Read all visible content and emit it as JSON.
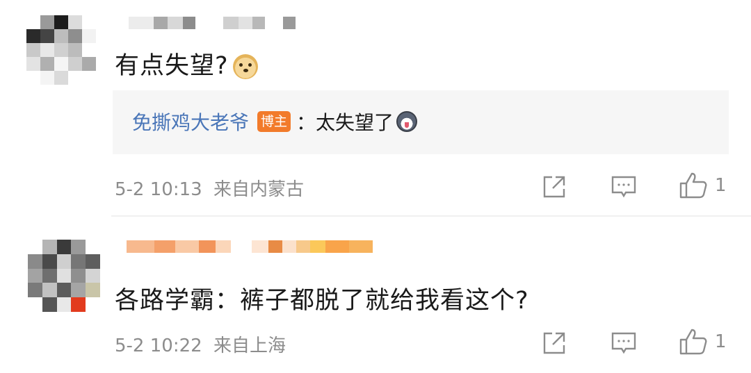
{
  "comments": [
    {
      "text": "有点失望?",
      "emoji": "doge-emoji",
      "reply": {
        "author": "免撕鸡大老爷",
        "badge": "博主",
        "separator": "：",
        "text": "太失望了",
        "emoji": "husky-emoji"
      },
      "time": "5-2 10:13",
      "location": "来自内蒙古",
      "likes": "1"
    },
    {
      "text": "各路学霸：裤子都脱了就给我看这个?",
      "time": "5-2 10:22",
      "location": "来自上海",
      "likes": "1"
    }
  ],
  "icons": {
    "share": "share-icon",
    "comment": "comment-icon",
    "like": "like-icon"
  },
  "colors": {
    "author_link": "#4a76b8",
    "badge_bg": "#f27b2b",
    "meta_text": "#8c8c8c",
    "reply_bg": "#f6f6f6"
  }
}
